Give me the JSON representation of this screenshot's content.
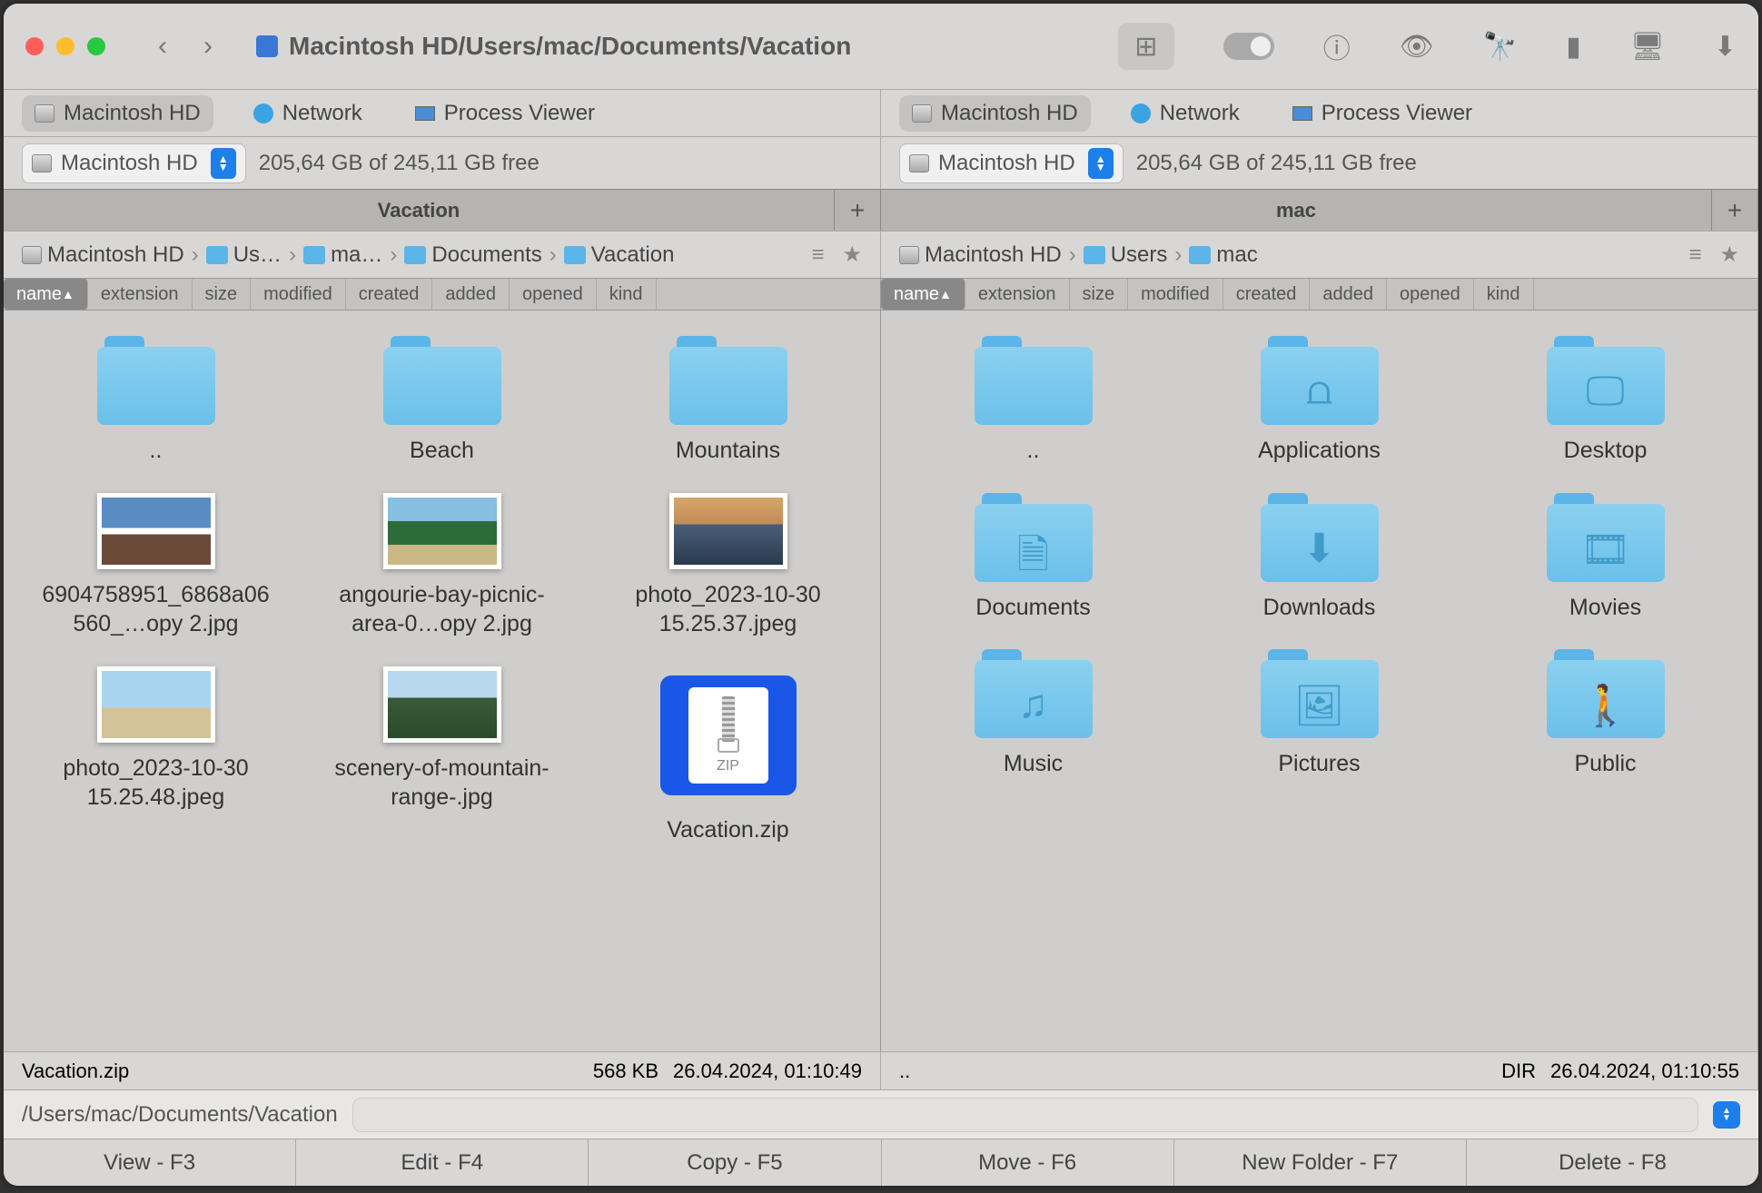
{
  "title_path": "Macintosh HD/Users/mac/Documents/Vacation",
  "drives": {
    "hd": "Macintosh HD",
    "network": "Network",
    "process": "Process Viewer"
  },
  "volume": {
    "name": "Macintosh HD",
    "free": "205,64 GB of 245,11 GB free"
  },
  "left": {
    "tab": "Vacation",
    "breadcrumb": [
      "Macintosh HD",
      "Us…",
      "ma…",
      "Documents",
      "Vacation"
    ],
    "status": {
      "name": "Vacation.zip",
      "size": "568 KB",
      "date": "26.04.2024, 01:10:49"
    },
    "items": [
      {
        "label": "..",
        "type": "folder"
      },
      {
        "label": "Beach",
        "type": "folder"
      },
      {
        "label": "Mountains",
        "type": "folder"
      },
      {
        "label": "6904758951_6868a06560_…opy 2.jpg",
        "type": "img",
        "thumb": "mountain"
      },
      {
        "label": "angourie-bay-picnic-area-0…opy 2.jpg",
        "type": "img",
        "thumb": "beach"
      },
      {
        "label": "photo_2023-10-30 15.25.37.jpeg",
        "type": "img",
        "thumb": "sunset"
      },
      {
        "label": "photo_2023-10-30 15.25.48.jpeg",
        "type": "img",
        "thumb": "sand"
      },
      {
        "label": "scenery-of-mountain-range-.jpg",
        "type": "img",
        "thumb": "range"
      },
      {
        "label": "Vacation.zip",
        "type": "zip",
        "highlighted": true
      }
    ]
  },
  "right": {
    "tab": "mac",
    "breadcrumb": [
      "Macintosh HD",
      "Users",
      "mac"
    ],
    "status": {
      "name": "..",
      "size": "DIR",
      "date": "26.04.2024, 01:10:55"
    },
    "items": [
      {
        "label": "..",
        "type": "folder"
      },
      {
        "label": "Applications",
        "type": "folder",
        "glyph": "⩍"
      },
      {
        "label": "Desktop",
        "type": "folder",
        "glyph": "🖵"
      },
      {
        "label": "Documents",
        "type": "folder",
        "glyph": "🗎"
      },
      {
        "label": "Downloads",
        "type": "folder",
        "glyph": "⬇"
      },
      {
        "label": "Movies",
        "type": "folder",
        "glyph": "🎞"
      },
      {
        "label": "Music",
        "type": "folder",
        "glyph": "♫"
      },
      {
        "label": "Pictures",
        "type": "folder",
        "glyph": "🖼"
      },
      {
        "label": "Public",
        "type": "folder",
        "glyph": "🚶"
      }
    ]
  },
  "columns": [
    "name",
    "extension",
    "size",
    "modified",
    "created",
    "added",
    "opened",
    "kind"
  ],
  "path_value": "/Users/mac/Documents/Vacation",
  "zip_text": "ZIP",
  "bottom": [
    "View - F3",
    "Edit - F4",
    "Copy - F5",
    "Move - F6",
    "New Folder - F7",
    "Delete - F8"
  ]
}
